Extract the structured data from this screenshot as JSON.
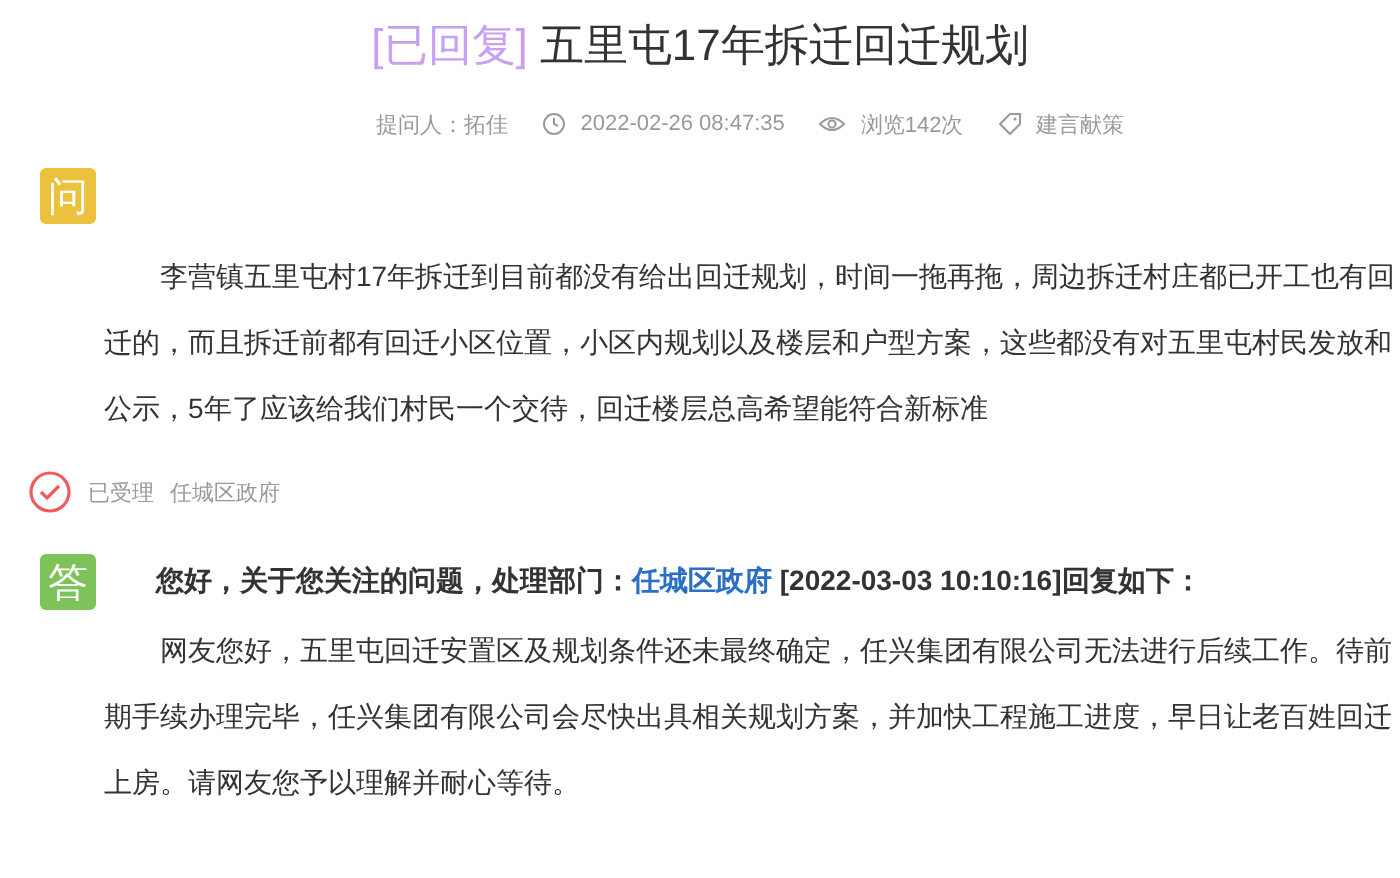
{
  "title": {
    "status": "[已回复]",
    "text": "五里屯17年拆迁回迁规划"
  },
  "meta": {
    "asker": "提问人：拓佳",
    "time": "2022-02-26 08:47:35",
    "views": "浏览142次",
    "category": "建言献策"
  },
  "question": {
    "badge": "问",
    "text": "李营镇五里屯村17年拆迁到目前都没有给出回迁规划，时间一拖再拖，周边拆迁村庄都已开工也有回迁的，而且拆迁前都有回迁小区位置，小区内规划以及楼层和户型方案，这些都没有对五里屯村民发放和公示，5年了应该给我们村民一个交待，回迁楼层总高希望能符合新标准"
  },
  "status": {
    "accepted": true,
    "label": "已受理",
    "department": "任城区政府"
  },
  "answer": {
    "badge": "答",
    "intro": "您好，关于您关注的问题，处理部门：",
    "department": "任城区政府",
    "suffix": "[2022-03-03 10:10:16]回复如下：",
    "text": "网友您好，五里屯回迁安置区及规划条件还未最终确定，任兴集团有限公司无法进行后续工作。待前期手续办理完毕，任兴集团有限公司会尽快出具相关规划方案，并加快工程施工进度，早日让老百姓回迁上房。请网友您予以理解并耐心等待。"
  }
}
